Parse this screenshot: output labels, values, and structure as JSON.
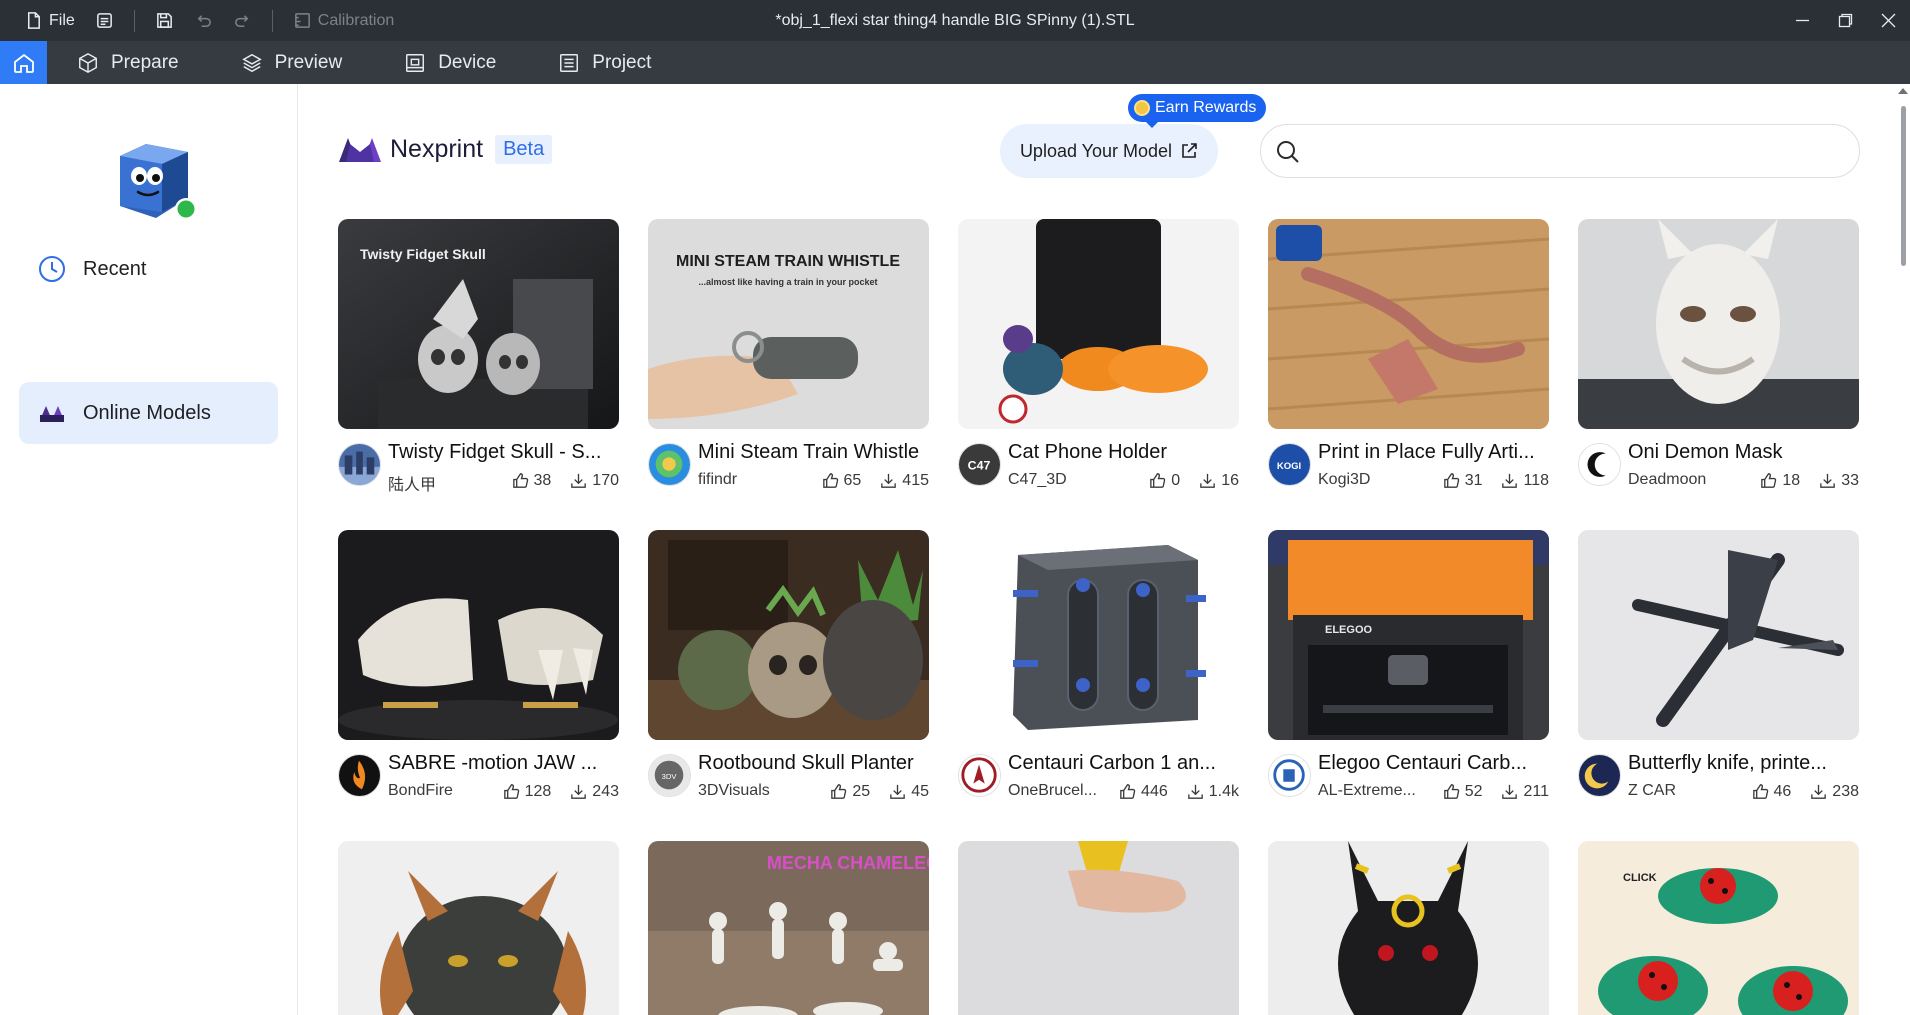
{
  "titlebar": {
    "file_label": "File",
    "calibration_label": "Calibration",
    "window_title": "*obj_1_flexi star thing4 handle BIG SPinny (1).STL"
  },
  "tabs": [
    {
      "label": "Prepare",
      "icon": "cube-icon"
    },
    {
      "label": "Preview",
      "icon": "layers-icon"
    },
    {
      "label": "Device",
      "icon": "device-icon"
    },
    {
      "label": "Project",
      "icon": "project-icon"
    }
  ],
  "sidebar": {
    "items": [
      {
        "label": "Recent",
        "icon": "clock-icon"
      },
      {
        "label": "Online Models",
        "icon": "models-icon",
        "active": true
      }
    ]
  },
  "header": {
    "brand": "Nexprint",
    "beta": "Beta",
    "upload_label": "Upload Your Model",
    "rewards_label": "Earn Rewards",
    "search_placeholder": ""
  },
  "cards": [
    {
      "title": "Twisty Fidget Skull - S...",
      "author": "陆人甲",
      "likes": "38",
      "downloads": "170",
      "thumb_text": "Twisty Fidget Skull"
    },
    {
      "title": "Mini Steam Train Whistle",
      "author": "fifindr",
      "likes": "65",
      "downloads": "415",
      "thumb_text": "MINI STEAM TRAIN WHISTLE",
      "thumb_sub": "...almost like having a train in your pocket"
    },
    {
      "title": "Cat Phone Holder",
      "author": "C47_3D",
      "likes": "0",
      "downloads": "16"
    },
    {
      "title": "Print in Place Fully Arti...",
      "author": "Kogi3D",
      "likes": "31",
      "downloads": "118"
    },
    {
      "title": "Oni Demon Mask",
      "author": "Deadmoon",
      "likes": "18",
      "downloads": "33"
    },
    {
      "title": "SABRE -motion JAW ...",
      "author": "BondFire",
      "likes": "128",
      "downloads": "243"
    },
    {
      "title": "Rootbound Skull Planter",
      "author": "3DVisuals",
      "likes": "25",
      "downloads": "45"
    },
    {
      "title": "Centauri Carbon 1 an...",
      "author": "OneBrucel...",
      "likes": "446",
      "downloads": "1.4k"
    },
    {
      "title": "Elegoo Centauri Carb...",
      "author": "AL-Extreme...",
      "likes": "52",
      "downloads": "211",
      "thumb_text": "ELEGOO"
    },
    {
      "title": "Butterfly knife, printe...",
      "author": "Z CAR",
      "likes": "46",
      "downloads": "238"
    },
    {
      "title": "",
      "author": "",
      "likes": "",
      "downloads": ""
    },
    {
      "title": "",
      "author": "",
      "likes": "",
      "downloads": "",
      "thumb_text": "MECHA CHAMELEON"
    },
    {
      "title": "",
      "author": "",
      "likes": "",
      "downloads": ""
    },
    {
      "title": "",
      "author": "",
      "likes": "",
      "downloads": ""
    },
    {
      "title": "",
      "author": "",
      "likes": "",
      "downloads": "",
      "thumb_text": "CLICK"
    }
  ],
  "colors": {
    "accent": "#2f7cf6",
    "titlebar_bg": "#2b3036",
    "tabbar_bg": "#363b41",
    "active_item_bg": "#e4eefc",
    "rewards_bg": "#1a63f0"
  }
}
